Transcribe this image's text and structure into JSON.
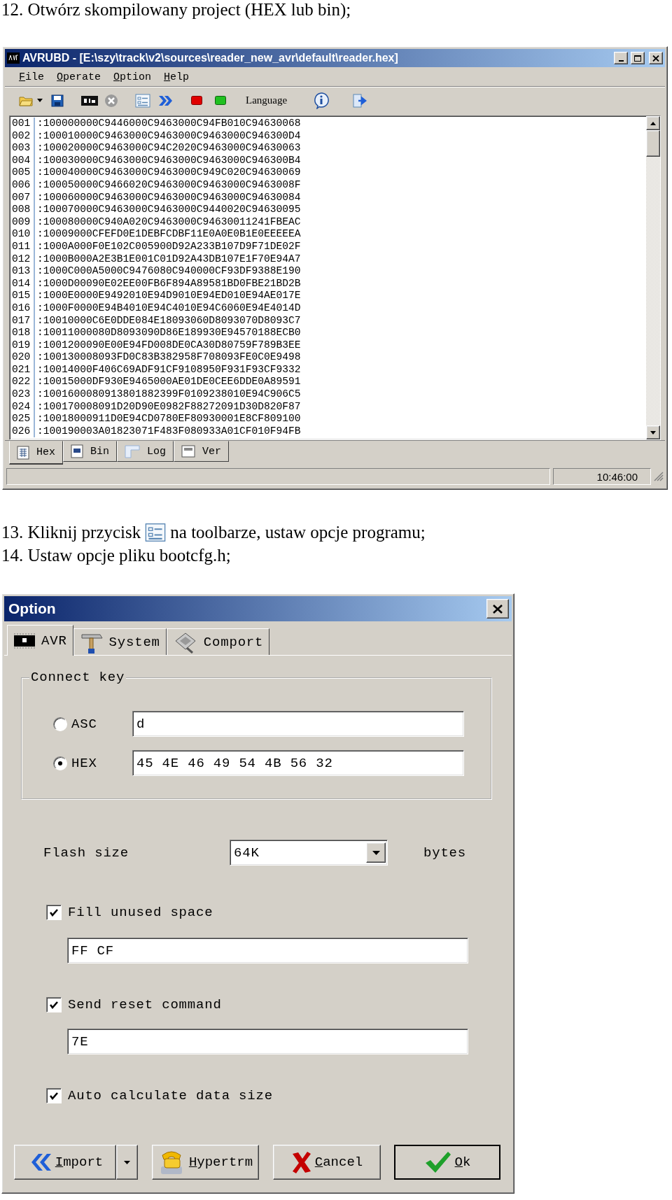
{
  "step_12": "12. Otwórz skompilowany project (HEX lub bin);",
  "main_window": {
    "title": "AVRUBD - [E:\\szy\\track\\v2\\sources\\reader_new_avr\\default\\reader.hex]",
    "menu": [
      "File",
      "Operate",
      "Option",
      "Help"
    ],
    "toolbar_label": "Language",
    "hex_lines": [
      {
        "number": "001",
        "text": ":100000000C9446000C9463000C94FB010C94630068"
      },
      {
        "number": "002",
        "text": ":100010000C9463000C9463000C9463000C946300D4"
      },
      {
        "number": "003",
        "text": ":100020000C9463000C94C2020C9463000C94630063"
      },
      {
        "number": "004",
        "text": ":100030000C9463000C9463000C9463000C946300B4"
      },
      {
        "number": "005",
        "text": ":100040000C9463000C9463000C949C020C94630069"
      },
      {
        "number": "006",
        "text": ":100050000C9466020C9463000C9463000C9463008F"
      },
      {
        "number": "007",
        "text": ":100060000C9463000C9463000C9463000C94630084"
      },
      {
        "number": "008",
        "text": ":100070000C9463000C9463000C9440020C94630095"
      },
      {
        "number": "009",
        "text": ":100080000C940A020C9463000C94630011241FBEAC"
      },
      {
        "number": "010",
        "text": ":10009000CFEFD0E1DEBFCDBF11E0A0E0B1E0EEEEEA"
      },
      {
        "number": "011",
        "text": ":1000A000F0E102C005900D92A233B107D9F71DE02F"
      },
      {
        "number": "012",
        "text": ":1000B000A2E3B1E001C01D92A43DB107E1F70E94A7"
      },
      {
        "number": "013",
        "text": ":1000C000A5000C9476080C940000CF93DF9388E190"
      },
      {
        "number": "014",
        "text": ":1000D00090E02EE00FB6F894A89581BD0FBE21BD2B"
      },
      {
        "number": "015",
        "text": ":1000E0000E9492010E94D9010E94ED010E94AE017E"
      },
      {
        "number": "016",
        "text": ":1000F0000E94B4010E94C4010E94C6060E94E4014D"
      },
      {
        "number": "017",
        "text": ":10010000C6E0DDE084E18093060D8093070D8093C7"
      },
      {
        "number": "018",
        "text": ":10011000080D8093090D86E189930E94570188ECB0"
      },
      {
        "number": "019",
        "text": ":1001200090E00E94FD008DE0CA30D80759F789B3EE"
      },
      {
        "number": "020",
        "text": ":100130008093FD0C83B382958F708093FE0C0E9498"
      },
      {
        "number": "021",
        "text": ":10014000F406C69ADF91CF9108950F931F93CF9332"
      },
      {
        "number": "022",
        "text": ":10015000DF930E9465000AE01DE0CEE6DDE0A89591"
      },
      {
        "number": "023",
        "text": ":1001600080913801882399F0109238010E94C906C5"
      },
      {
        "number": "024",
        "text": ":100170008091D20D90E0982F88272091D30D820F87"
      },
      {
        "number": "025",
        "text": ":10018000911D0E94CD0780EF80930001E8CF809100"
      },
      {
        "number": "026",
        "text": ":100190003A01823071F483F080933A01CF010F94FB"
      }
    ],
    "tabs": [
      {
        "label": "Hex",
        "selected": true
      },
      {
        "label": "Bin",
        "selected": false
      },
      {
        "label": "Log",
        "selected": false
      },
      {
        "label": "Ver",
        "selected": false
      }
    ],
    "status_time": "10:46:00"
  },
  "step_13": {
    "before_icon": "13. Kliknij przycisk",
    "after_icon": "na toolbarze, ustaw opcje programu;"
  },
  "step_14": "14. Ustaw opcje pliku bootcfg.h;",
  "option_dialog": {
    "title": "Option",
    "tabs": [
      {
        "label": "AVR",
        "selected": true
      },
      {
        "label": "System",
        "selected": false
      },
      {
        "label": "Comport",
        "selected": false
      }
    ],
    "connect_key": {
      "title": "Connect key",
      "options": [
        {
          "label": "ASC",
          "selected": false,
          "value": "d"
        },
        {
          "label": "HEX",
          "selected": true,
          "value": "45 4E 46 49 54 4B 56 32"
        }
      ]
    },
    "flash_size": {
      "label": "Flash size",
      "value": "64K",
      "unit": "bytes"
    },
    "checkboxes": [
      {
        "label": "Fill unused space",
        "checked": true,
        "value": "FF CF"
      },
      {
        "label": "Send reset command",
        "checked": true,
        "value": "7E"
      },
      {
        "label": "Auto calculate data size",
        "checked": true
      }
    ],
    "buttons": [
      {
        "label": "Import",
        "kind": "import"
      },
      {
        "label": "Hypertrm",
        "kind": "hypertrm"
      },
      {
        "label": "Cancel",
        "kind": "cancel"
      },
      {
        "label": "Ok",
        "kind": "ok"
      }
    ]
  }
}
